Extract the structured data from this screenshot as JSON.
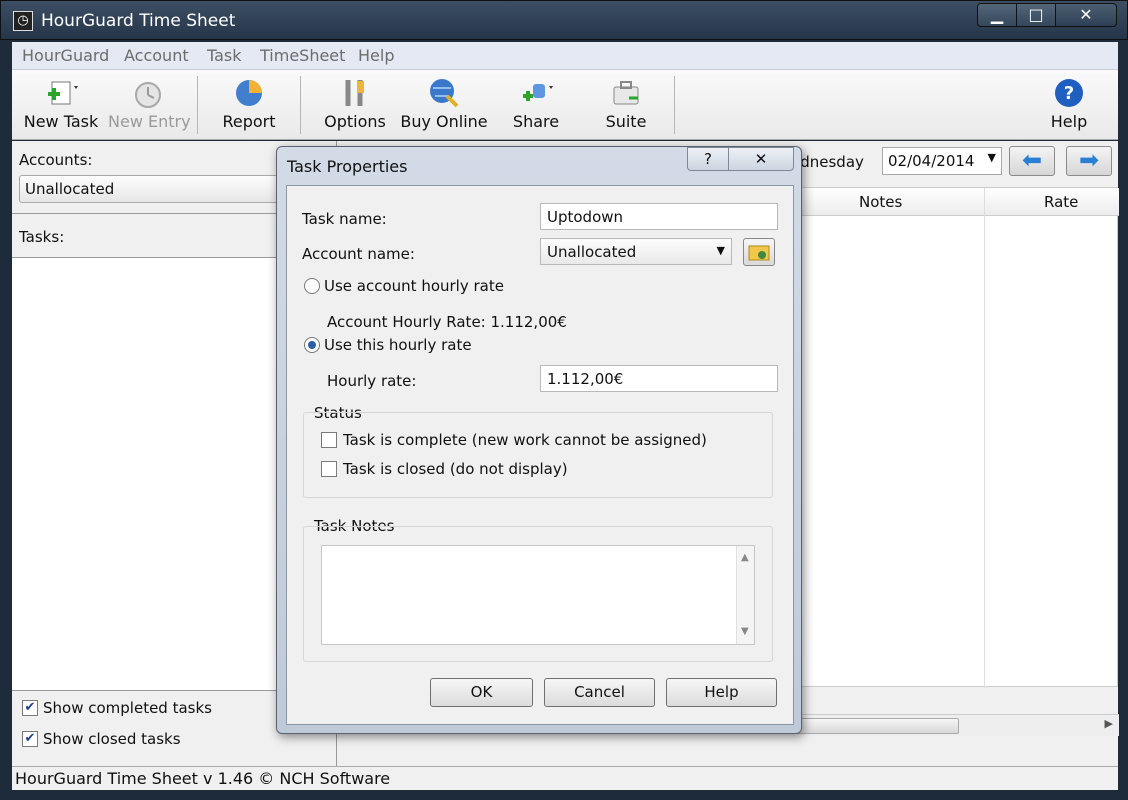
{
  "window": {
    "title": "HourGuard Time Sheet",
    "icon": "clock-icon"
  },
  "menu": [
    "HourGuard",
    "Account",
    "Task",
    "TimeSheet",
    "Help"
  ],
  "toolbar": {
    "new_task": "New Task",
    "new_entry": "New Entry",
    "report": "Report",
    "options": "Options",
    "buy_online": "Buy Online",
    "share": "Share",
    "suite": "Suite",
    "help": "Help"
  },
  "left_panel": {
    "accounts_label": "Accounts:",
    "accounts_value": "Unallocated",
    "tasks_label": "Tasks:",
    "show_completed": "Show completed tasks",
    "show_closed": "Show closed tasks"
  },
  "right_panel": {
    "day": "ednesday",
    "date": "02/04/2014",
    "columns": {
      "notes": "Notes",
      "rate": "Rate"
    }
  },
  "status_bar": "HourGuard Time Sheet v 1.46 © NCH Software",
  "dialog": {
    "title": "Task Properties",
    "help_glyph": "?",
    "close_glyph": "✕",
    "task_name_label": "Task name:",
    "task_name_value": "Uptodown",
    "account_name_label": "Account name:",
    "account_name_value": "Unallocated",
    "use_account_rate": "Use account hourly rate",
    "account_rate_text": "Account Hourly Rate: 1.112,00€",
    "use_this_rate": "Use this hourly rate",
    "hourly_rate_label": "Hourly rate:",
    "hourly_rate_value": "1.112,00€",
    "status_group": "Status",
    "task_complete": "Task is complete (new work cannot be assigned)",
    "task_closed": "Task is closed (do not display)",
    "notes_group": "Task Notes",
    "ok": "OK",
    "cancel": "Cancel",
    "help": "Help"
  }
}
